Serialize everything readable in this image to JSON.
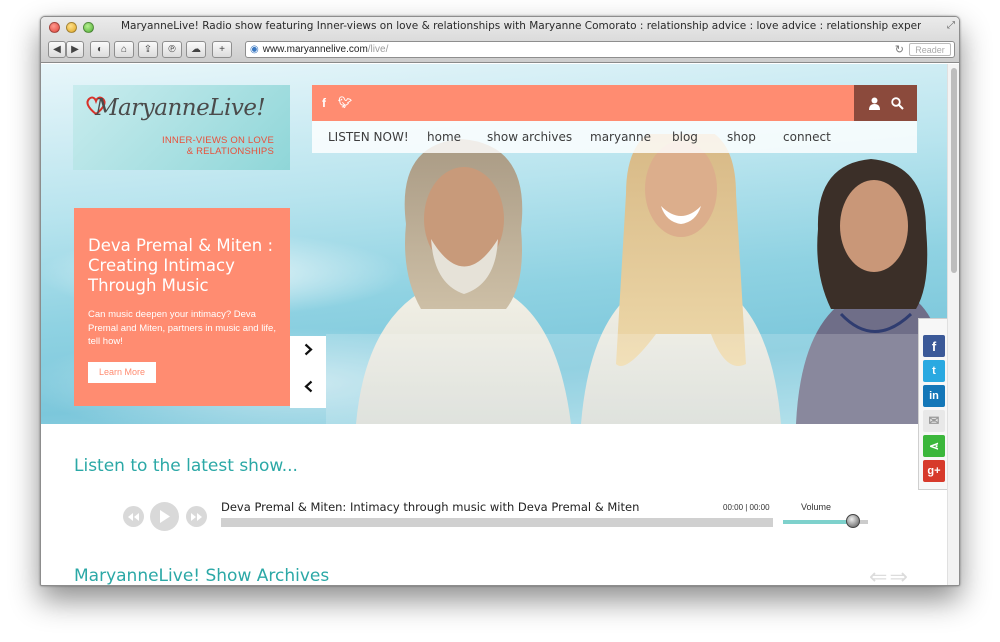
{
  "browser": {
    "title": "MaryanneLive! Radio show featuring Inner-views on love & relationships with Maryanne Comorato : relationship advice : love advice : relationship expert",
    "url_host": "www.maryannelive.com",
    "url_path": "/live/",
    "reader_label": "Reader"
  },
  "logo": {
    "name": "MaryanneLive!",
    "tagline_1": "INNER-VIEWS ON LOVE",
    "tagline_2": "& RELATIONSHIPS"
  },
  "nav": {
    "items": [
      "LISTEN NOW!",
      "home",
      "show archives",
      "maryanne",
      "blog",
      "shop",
      "connect"
    ]
  },
  "feature": {
    "title": "Deva Premal & Miten : Creating Intimacy Through Music",
    "summary": "Can music deepen your intimacy? Deva Premal and Miten, partners in music and life, tell how!",
    "button": "Learn More"
  },
  "latest": {
    "heading": "Listen to the latest show...",
    "track_title": "Deva Premal & Miten: Intimacy through music with Deva Premal & Miten",
    "time": "00:00  |  00:00",
    "volume_label": "Volume",
    "volume_level": 0.82
  },
  "archives": {
    "heading": "MaryanneLive! Show Archives"
  },
  "colors": {
    "coral": "#ff8c71",
    "teal": "#2ba8a6",
    "brown": "#8b4a3c"
  },
  "share": [
    "facebook-icon",
    "twitter-icon",
    "linkedin-icon",
    "email-icon",
    "share-icon",
    "google-plus-icon"
  ]
}
